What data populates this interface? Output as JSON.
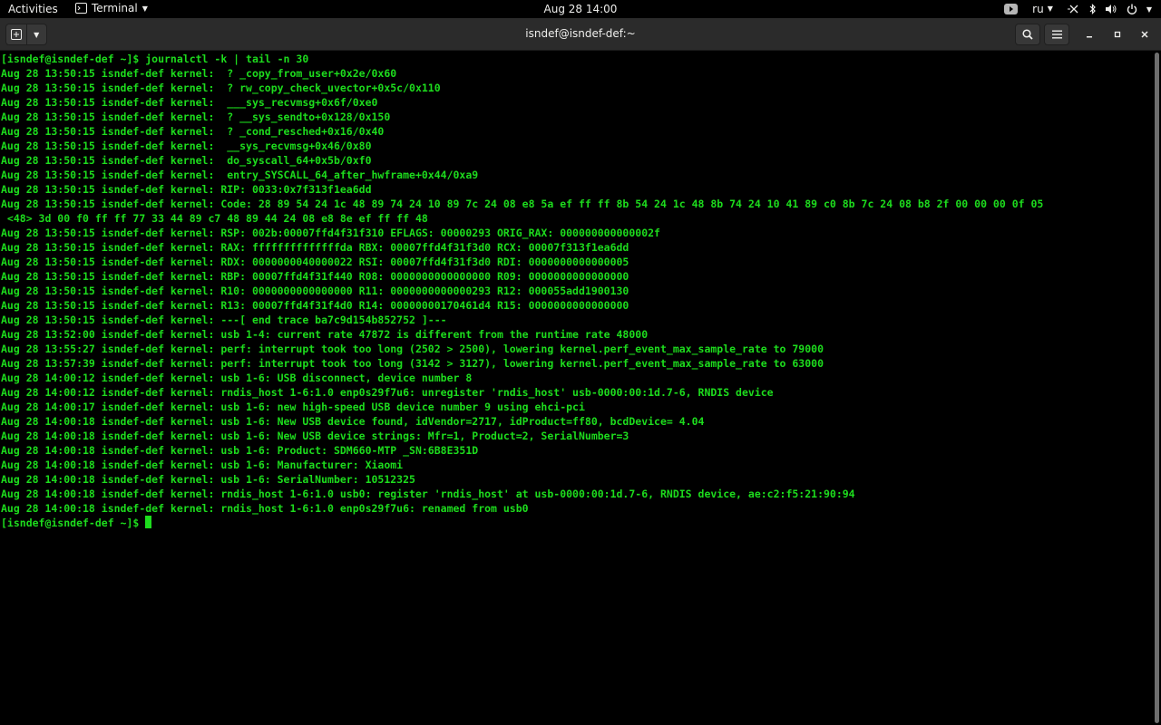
{
  "topbar": {
    "activities": "Activities",
    "app_name": "Terminal",
    "clock": "Aug 28  14:00",
    "keyboard_layout": "ru"
  },
  "icons": {
    "terminal_app": "terminal-app-icon",
    "video": "video-icon",
    "network": "network-icon",
    "bluetooth": "bluetooth-icon",
    "volume": "volume-icon",
    "power": "power-icon"
  },
  "window": {
    "title": "isndef@isndef-def:~"
  },
  "terminal": {
    "lines": [
      "[isndef@isndef-def ~]$ journalctl -k | tail -n 30",
      "Aug 28 13:50:15 isndef-def kernel:  ? _copy_from_user+0x2e/0x60",
      "Aug 28 13:50:15 isndef-def kernel:  ? rw_copy_check_uvector+0x5c/0x110",
      "Aug 28 13:50:15 isndef-def kernel:  ___sys_recvmsg+0x6f/0xe0",
      "Aug 28 13:50:15 isndef-def kernel:  ? __sys_sendto+0x128/0x150",
      "Aug 28 13:50:15 isndef-def kernel:  ? _cond_resched+0x16/0x40",
      "Aug 28 13:50:15 isndef-def kernel:  __sys_recvmsg+0x46/0x80",
      "Aug 28 13:50:15 isndef-def kernel:  do_syscall_64+0x5b/0xf0",
      "Aug 28 13:50:15 isndef-def kernel:  entry_SYSCALL_64_after_hwframe+0x44/0xa9",
      "Aug 28 13:50:15 isndef-def kernel: RIP: 0033:0x7f313f1ea6dd",
      "Aug 28 13:50:15 isndef-def kernel: Code: 28 89 54 24 1c 48 89 74 24 10 89 7c 24 08 e8 5a ef ff ff 8b 54 24 1c 48 8b 74 24 10 41 89 c0 8b 7c 24 08 b8 2f 00 00 00 0f 05",
      " <48> 3d 00 f0 ff ff 77 33 44 89 c7 48 89 44 24 08 e8 8e ef ff ff 48",
      "Aug 28 13:50:15 isndef-def kernel: RSP: 002b:00007ffd4f31f310 EFLAGS: 00000293 ORIG_RAX: 000000000000002f",
      "Aug 28 13:50:15 isndef-def kernel: RAX: ffffffffffffffda RBX: 00007ffd4f31f3d0 RCX: 00007f313f1ea6dd",
      "Aug 28 13:50:15 isndef-def kernel: RDX: 0000000040000022 RSI: 00007ffd4f31f3d0 RDI: 0000000000000005",
      "Aug 28 13:50:15 isndef-def kernel: RBP: 00007ffd4f31f440 R08: 0000000000000000 R09: 0000000000000000",
      "Aug 28 13:50:15 isndef-def kernel: R10: 0000000000000000 R11: 0000000000000293 R12: 000055add1900130",
      "Aug 28 13:50:15 isndef-def kernel: R13: 00007ffd4f31f4d0 R14: 00000000170461d4 R15: 0000000000000000",
      "Aug 28 13:50:15 isndef-def kernel: ---[ end trace ba7c9d154b852752 ]---",
      "Aug 28 13:52:00 isndef-def kernel: usb 1-4: current rate 47872 is different from the runtime rate 48000",
      "Aug 28 13:55:27 isndef-def kernel: perf: interrupt took too long (2502 > 2500), lowering kernel.perf_event_max_sample_rate to 79000",
      "Aug 28 13:57:39 isndef-def kernel: perf: interrupt took too long (3142 > 3127), lowering kernel.perf_event_max_sample_rate to 63000",
      "Aug 28 14:00:12 isndef-def kernel: usb 1-6: USB disconnect, device number 8",
      "Aug 28 14:00:12 isndef-def kernel: rndis_host 1-6:1.0 enp0s29f7u6: unregister 'rndis_host' usb-0000:00:1d.7-6, RNDIS device",
      "Aug 28 14:00:17 isndef-def kernel: usb 1-6: new high-speed USB device number 9 using ehci-pci",
      "Aug 28 14:00:18 isndef-def kernel: usb 1-6: New USB device found, idVendor=2717, idProduct=ff80, bcdDevice= 4.04",
      "Aug 28 14:00:18 isndef-def kernel: usb 1-6: New USB device strings: Mfr=1, Product=2, SerialNumber=3",
      "Aug 28 14:00:18 isndef-def kernel: usb 1-6: Product: SDM660-MTP _SN:6B8E351D",
      "Aug 28 14:00:18 isndef-def kernel: usb 1-6: Manufacturer: Xiaomi",
      "Aug 28 14:00:18 isndef-def kernel: usb 1-6: SerialNumber: 10512325",
      "Aug 28 14:00:18 isndef-def kernel: rndis_host 1-6:1.0 usb0: register 'rndis_host' at usb-0000:00:1d.7-6, RNDIS device, ae:c2:f5:21:90:94",
      "Aug 28 14:00:18 isndef-def kernel: rndis_host 1-6:1.0 enp0s29f7u6: renamed from usb0"
    ],
    "prompt": "[isndef@isndef-def ~]$ ",
    "text_color": "#1ddc1d",
    "background": "#000000"
  }
}
